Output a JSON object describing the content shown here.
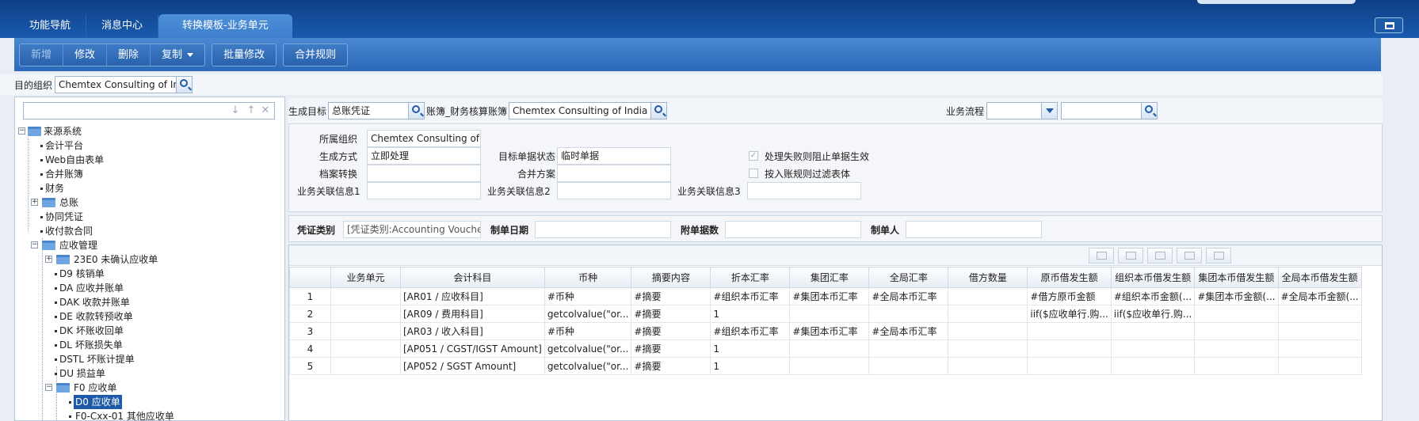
{
  "tabs": [
    "功能导航",
    "消息中心",
    "转换模板-业务单元"
  ],
  "toolbar": {
    "new": "新增",
    "edit": "修改",
    "delete": "删除",
    "copy": "复制",
    "batch_edit": "批量修改",
    "merge_rule": "合并规则"
  },
  "org": {
    "label": "目的组织",
    "value": "Chemtex Consulting of India (P\\"
  },
  "tree": {
    "search_value": "",
    "nodes": [
      {
        "label": "来源系统"
      },
      {
        "label": "会计平台"
      },
      {
        "label": "Web自由表单"
      },
      {
        "label": "合并账簿"
      },
      {
        "label": "财务"
      },
      {
        "label": "总账"
      },
      {
        "label": "协同凭证"
      },
      {
        "label": "收付款合同"
      },
      {
        "label": "应收管理"
      },
      {
        "label": "23E0 未确认应收单"
      },
      {
        "label": "D9 核销单"
      },
      {
        "label": "DA 应收并账单"
      },
      {
        "label": "DAK 收款并账单"
      },
      {
        "label": "DE 收款转预收单"
      },
      {
        "label": "DK 坏账收回单"
      },
      {
        "label": "DL 坏账损失单"
      },
      {
        "label": "DSTL 坏账计提单"
      },
      {
        "label": "DU 损益单"
      },
      {
        "label": "F0 应收单"
      },
      {
        "label": "D0 应收单"
      },
      {
        "label": "F0-Cxx-01 其他应收单"
      }
    ]
  },
  "target_row": {
    "target_label": "生成目标",
    "target_value": "总账凭证",
    "book_label": "账簿_财务核算账簿",
    "book_value": "Chemtex Consulting of India (P\\",
    "flow_label": "业务流程",
    "flow_value": "",
    "flow_search_value": ""
  },
  "info": {
    "org_label": "所属组织",
    "org_value": "Chemtex Consulting of India",
    "gen_mode_label": "生成方式",
    "gen_mode_value": "立即处理",
    "target_state_label": "目标单据状态",
    "target_state_value": "临时单据",
    "fail_block_label": "处理失败则阻止单据生效",
    "archive_label": "档案转换",
    "archive_value": "",
    "merge_plan_label": "合并方案",
    "merge_plan_value": "",
    "filter_label": "按入账规则过滤表体",
    "rel1_label": "业务关联信息1",
    "rel1_value": "",
    "rel2_label": "业务关联信息2",
    "rel2_value": "",
    "rel3_label": "业务关联信息3",
    "rel3_value": ""
  },
  "voucher": {
    "type_label": "凭证类别",
    "type_value": "[凭证类别:Accounting Voucher]",
    "date_label": "制单日期",
    "date_value": "",
    "attach_label": "附单据数",
    "attach_value": "",
    "maker_label": "制单人",
    "maker_value": ""
  },
  "grid": {
    "columns": [
      "",
      "业务单元",
      "会计科目",
      "币种",
      "摘要内容",
      "折本汇率",
      "集团汇率",
      "全局汇率",
      "借方数量",
      "原币借发生额",
      "组织本币借发生额",
      "集团本币借发生额",
      "全局本币借发生额"
    ],
    "rows": [
      [
        "1",
        "",
        "[AR01 / 应收科目]",
        "#币种",
        "#摘要",
        "#组织本币汇率",
        "#集团本币汇率",
        "#全局本币汇率",
        "",
        "#借方原币金额",
        "#组织本币金额(...",
        "#集团本币金额(...",
        "#全局本币金额(..."
      ],
      [
        "2",
        "",
        "[AR09 / 费用科目]",
        "getcolvalue(\"or...",
        "#摘要",
        "1",
        "",
        "",
        "",
        "iif($应收单行.购...",
        "iif($应收单行.购...",
        "",
        ""
      ],
      [
        "3",
        "",
        "[AR03 / 收入科目]",
        "#币种",
        "#摘要",
        "#组织本币汇率",
        "#集团本币汇率",
        "#全局本币汇率",
        "",
        "",
        "",
        "",
        ""
      ],
      [
        "4",
        "",
        "[AP051 / CGST/IGST Amount]",
        "getcolvalue(\"or...",
        "#摘要",
        "1",
        "",
        "",
        "",
        "",
        "",
        "",
        ""
      ],
      [
        "5",
        "",
        "[AP052 / SGST Amount]",
        "getcolvalue(\"or...",
        "#摘要",
        "1",
        "",
        "",
        "",
        "",
        "",
        "",
        ""
      ]
    ]
  }
}
